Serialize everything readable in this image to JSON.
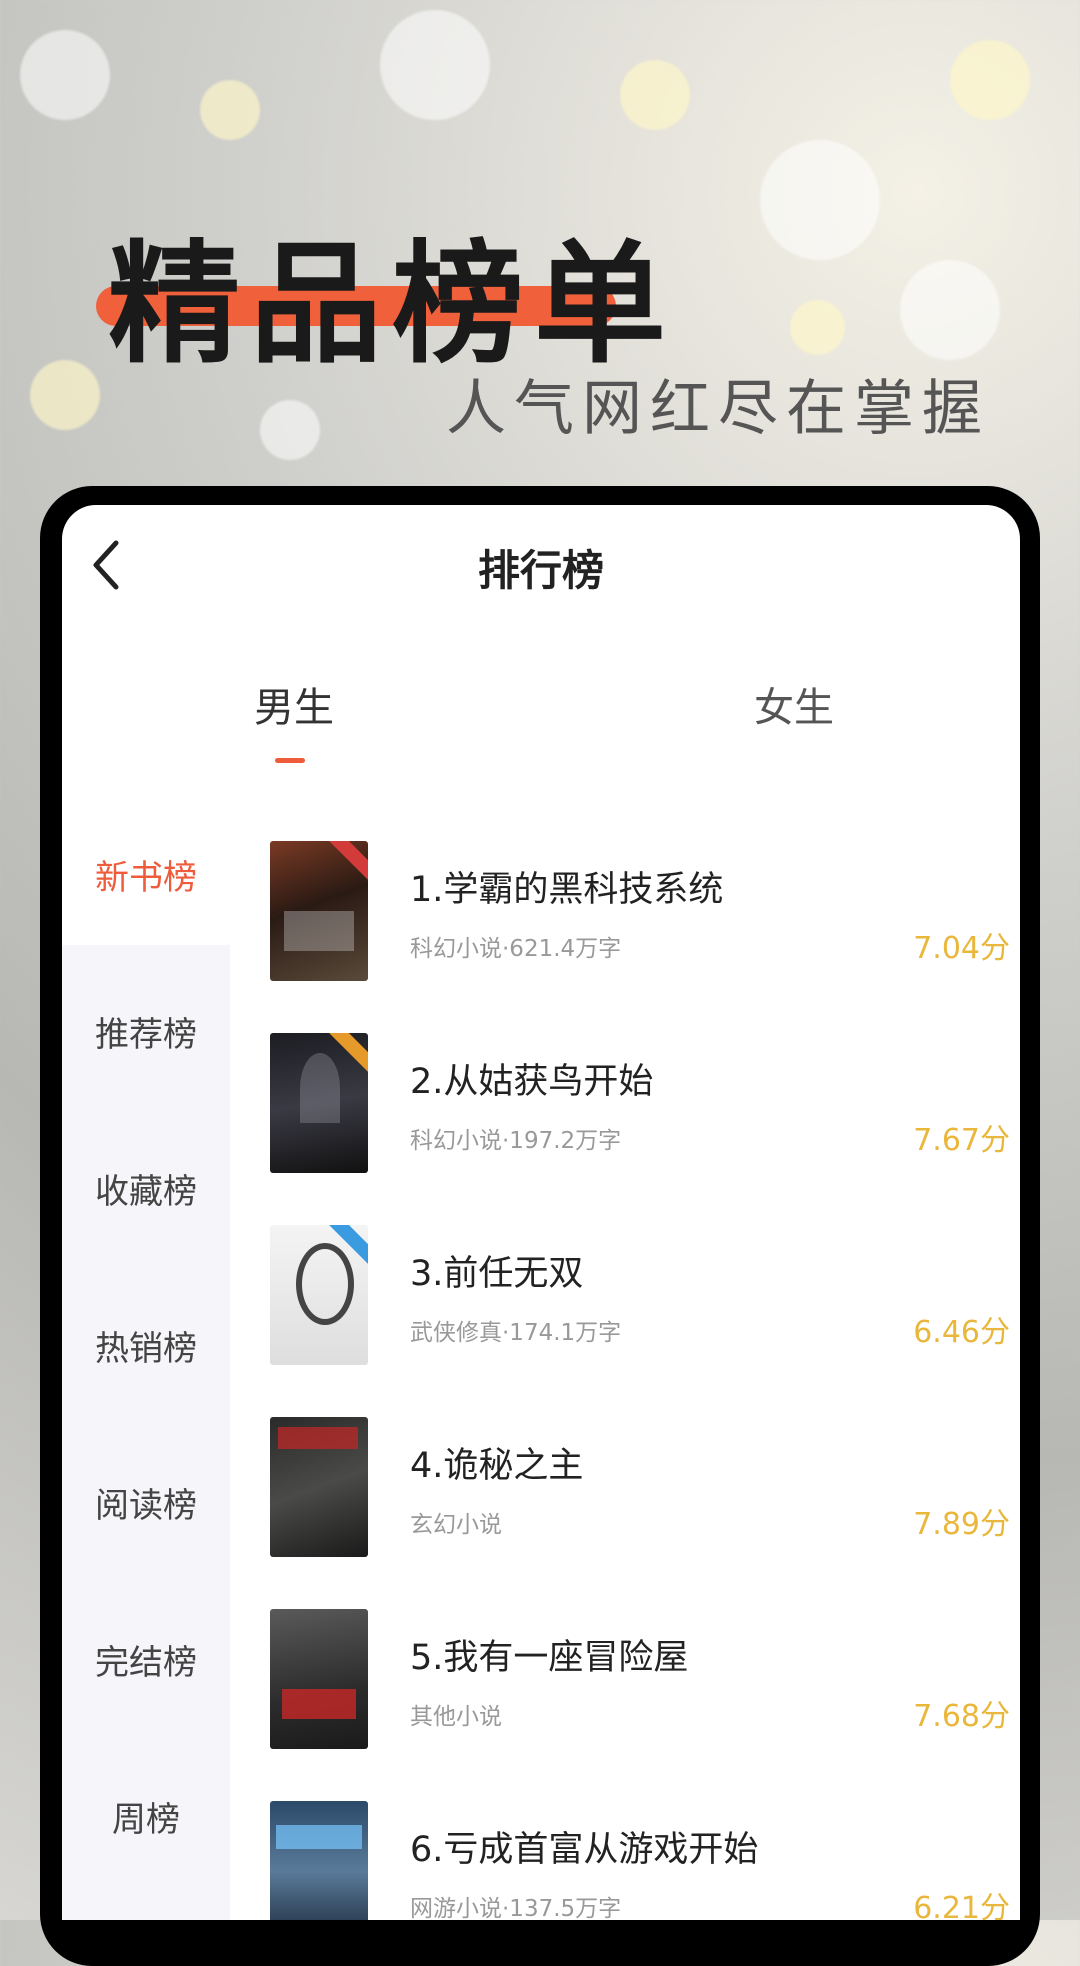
{
  "promo": {
    "title": "精品榜单",
    "subtitle": "人气网红尽在掌握"
  },
  "header": {
    "title": "排行榜"
  },
  "tabs": [
    {
      "label": "男生",
      "active": true
    },
    {
      "label": "女生",
      "active": false
    }
  ],
  "sidebar": {
    "items": [
      {
        "label": "新书榜",
        "active": true
      },
      {
        "label": "推荐榜",
        "active": false
      },
      {
        "label": "收藏榜",
        "active": false
      },
      {
        "label": "热销榜",
        "active": false
      },
      {
        "label": "阅读榜",
        "active": false
      },
      {
        "label": "完结榜",
        "active": false
      },
      {
        "label": "周榜",
        "active": false
      }
    ]
  },
  "books": [
    {
      "title": "1.学霸的黑科技系统",
      "meta": "科幻小说·621.4万字",
      "score": "7.04分"
    },
    {
      "title": "2.从姑获鸟开始",
      "meta": "科幻小说·197.2万字",
      "score": "7.67分"
    },
    {
      "title": "3.前任无双",
      "meta": "武侠修真·174.1万字",
      "score": "6.46分"
    },
    {
      "title": "4.诡秘之主",
      "meta": "玄幻小说",
      "score": "7.89分"
    },
    {
      "title": "5.我有一座冒险屋",
      "meta": "其他小说",
      "score": "7.68分"
    },
    {
      "title": "6.亏成首富从游戏开始",
      "meta": "网游小说·137.5万字",
      "score": "6.21分"
    }
  ],
  "colors": {
    "accent": "#ee5c3c",
    "score": "#e9b73c",
    "promo_underline": "#f0603b"
  }
}
